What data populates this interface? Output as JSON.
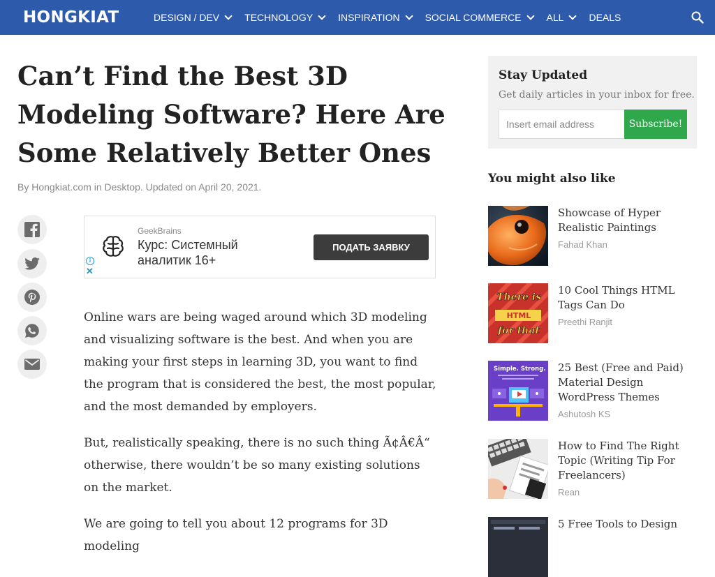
{
  "header": {
    "logo": "HONGKIAT",
    "nav": [
      {
        "label": "DESIGN / DEV",
        "dropdown": true
      },
      {
        "label": "TECHNOLOGY",
        "dropdown": true
      },
      {
        "label": "INSPIRATION",
        "dropdown": true
      },
      {
        "label": "SOCIAL COMMERCE",
        "dropdown": true
      },
      {
        "label": "ALL",
        "dropdown": true
      },
      {
        "label": "DEALS",
        "dropdown": false
      }
    ],
    "search_icon": "search-icon"
  },
  "article": {
    "title": "Can’t Find the Best 3D Modeling Software? Here Are Some Relatively Better Ones",
    "meta": {
      "prefix": "By ",
      "author": "Hongkiat.com",
      "in": " in ",
      "category": "Desktop",
      "updated": ". Updated on April 20, 2021."
    },
    "paragraphs": [
      "Online wars are being waged around which 3D modeling and visualizing software is the best. And when you are making your first steps in learning 3D, you want to find the program that is considered the best, the most popular, and the most demanded by employers.",
      "But, realistically speaking, there is no such thing Ã¢Â€Â“ otherwise, there wouldn’t be so many existing solutions on the market.",
      "We are going to tell you about 12 programs for 3D modeling"
    ]
  },
  "share": [
    {
      "icon": "facebook-icon"
    },
    {
      "icon": "twitter-icon"
    },
    {
      "icon": "pinterest-icon"
    },
    {
      "icon": "whatsapp-icon"
    },
    {
      "icon": "email-icon"
    }
  ],
  "ad": {
    "brand": "GeekBrains",
    "text": "Курс: Системный аналитик 16+",
    "button": "ПОДАТЬ ЗАЯВКУ",
    "info_symbol": "i",
    "close_symbol": "✕"
  },
  "sidebar": {
    "newsletter": {
      "title": "Stay Updated",
      "subtitle": "Get daily articles in your inbox for free.",
      "placeholder": "Insert email address",
      "button": "Subscribe!"
    },
    "related_title": "You might also like",
    "related": [
      {
        "title": "Showcase of Hyper Realistic Paintings",
        "author": "Fahad Khan"
      },
      {
        "title": "10 Cool Things HTML Tags Can Do",
        "author": "Preethi Ranjit"
      },
      {
        "title": "25 Best (Free and Paid) Material Design WordPress Themes",
        "author": "Ashutosh KS"
      },
      {
        "title": "How to Find The Right Topic (Writing Tip For Freelancers)",
        "author": "Rean"
      },
      {
        "title": "5 Free Tools to Design",
        "author": ""
      }
    ],
    "thumb_text": {
      "html_tags": [
        "There is",
        "HTML",
        "for that"
      ],
      "material": "Simple. Strong."
    }
  },
  "colors": {
    "nav_bg": "#2e5aac",
    "subscribe_bg": "#2ea84a",
    "ad_button_bg": "#3c3c3c"
  }
}
